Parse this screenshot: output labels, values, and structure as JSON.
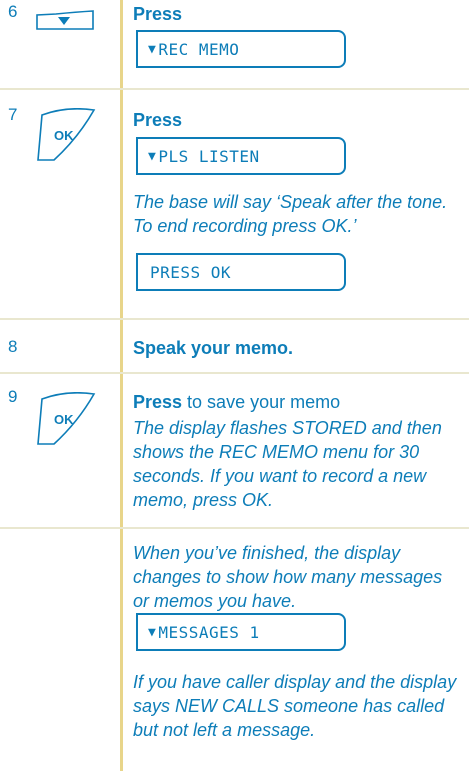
{
  "colors": {
    "accent": "#0d7db8",
    "divider": "#e8d58a",
    "row_line": "#e9e7cf"
  },
  "steps": [
    {
      "number": "6",
      "key": "down-arrow-key",
      "instruction_bold": "Press",
      "display": {
        "arrow": "▼",
        "text": "REC MEMO"
      }
    },
    {
      "number": "7",
      "key": "ok-key",
      "key_label": "OK",
      "instruction_bold": "Press",
      "display": {
        "arrow": "▼",
        "text": "PLS LISTEN"
      },
      "note": "The base will say ‘Speak after the tone. To end recording press OK.’",
      "display2": {
        "text": "PRESS OK"
      }
    },
    {
      "number": "8",
      "instruction_bold": "Speak your memo."
    },
    {
      "number": "9",
      "key": "ok-key",
      "key_label": "OK",
      "instruction_bold": "Press",
      "instruction_rest": " to save your memo",
      "note": "The display flashes STORED and then shows the REC MEMO menu for 30 seconds. If you want to record a new memo, press OK."
    },
    {
      "note": "When you’ve finished, the display changes to show how many messages or memos you have.",
      "display": {
        "arrow": "▼",
        "text": "MESSAGES 1"
      },
      "note2": "If you have caller display and the display says NEW CALLS someone has called but not left a message."
    }
  ]
}
